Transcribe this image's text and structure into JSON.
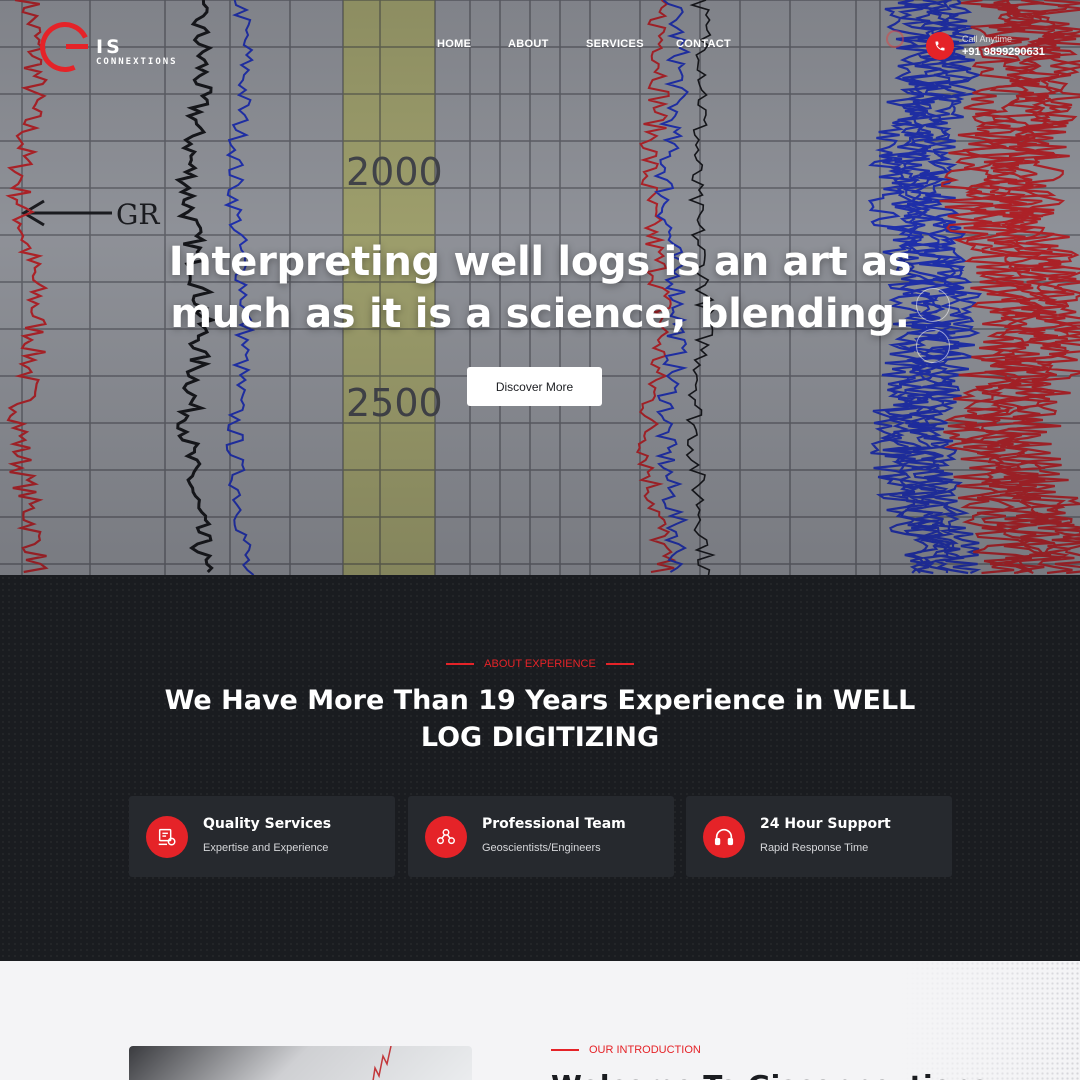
{
  "brand": {
    "mark": "IS",
    "sub": "CONNEXTIONS"
  },
  "nav": [
    {
      "label": "HOME"
    },
    {
      "label": "ABOUT"
    },
    {
      "label": "SERVICES"
    },
    {
      "label": "CONTACT"
    }
  ],
  "call": {
    "label": "Call Anytime",
    "number": "+91 9899290631"
  },
  "hero": {
    "title": "Interpreting well logs is an art as much as it is a science, blending.",
    "button": "Discover More",
    "background_labels": {
      "curve": "GR",
      "depth_top": "2000",
      "depth_bottom": "2500"
    }
  },
  "about": {
    "tag": "ABOUT EXPERIENCE",
    "heading": "We Have More Than 19 Years Experience in WELL LOG DIGITIZING",
    "features": [
      {
        "title": "Quality Services",
        "desc": "Expertise and Experience",
        "icon": "quality-icon"
      },
      {
        "title": "Professional Team",
        "desc": "Geoscientists/Engineers",
        "icon": "team-icon"
      },
      {
        "title": "24 Hour Support",
        "desc": "Rapid Response Time",
        "icon": "headset-icon"
      }
    ]
  },
  "intro": {
    "tag": "OUR INTRODUCTION",
    "heading_visible": "Welcome To Gisconnextions"
  },
  "colors": {
    "accent": "#e52328",
    "dark": "#1a1c20",
    "card": "#26292e"
  }
}
